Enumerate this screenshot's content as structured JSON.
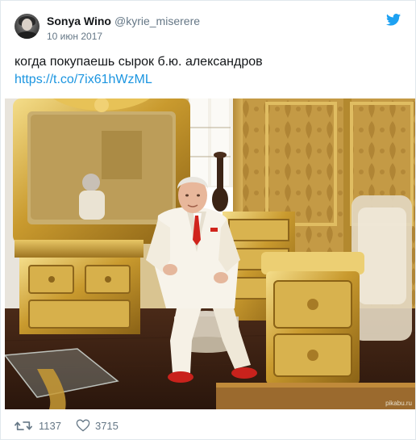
{
  "tweet": {
    "display_name": "Sonya Wino",
    "handle": "@kyrie_miserere",
    "date": "10 июн 2017",
    "text": "когда покупаешь сырок б.ю. александров",
    "link": "https://t.co/7ix61hWzML",
    "accent_color": "#1b95e0",
    "brand_icon": "twitter-bird-icon"
  },
  "photo": {
    "watermark": "pikabu.ru"
  },
  "actions": {
    "retweet_icon": "retweet-icon",
    "retweet_count": "1137",
    "like_icon": "heart-icon",
    "like_count": "3715"
  }
}
